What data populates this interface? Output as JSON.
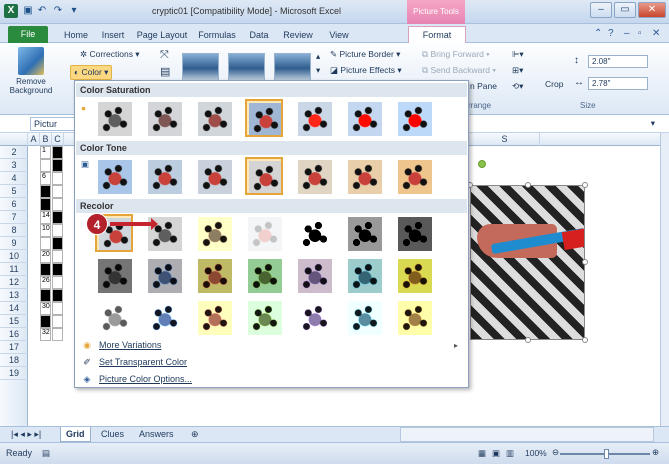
{
  "titlebar": {
    "app_icon": "X",
    "title": "cryptic01 [Compatibility Mode] - Microsoft Excel",
    "contextual_tab": "Picture Tools",
    "minimize": "–",
    "restore": "▭",
    "close": "✕"
  },
  "ribbon_tabs": [
    "File",
    "Home",
    "Insert",
    "Page Layout",
    "Formulas",
    "Data",
    "Review",
    "View",
    "Format"
  ],
  "ribbon": {
    "remove_background": "Remove Background",
    "corrections": "Corrections ▾",
    "color": "Color ▾",
    "picture_border": "Picture Border ▾",
    "picture_effects": "Picture Effects ▾",
    "bring_forward": "Bring Forward ▾",
    "send_backward": "Send Backward ▾",
    "selection_pane": "n Pane",
    "arrange_group": "rrange",
    "crop": "Crop",
    "height_value": "2.08\"",
    "width_value": "2.78\"",
    "size_group": "Size"
  },
  "formula_bar": {
    "name_box": "Pictur"
  },
  "sheet": {
    "column_headers": [
      "A",
      "B",
      "C",
      "S"
    ],
    "row_numbers": [
      "2",
      "3",
      "4",
      "5",
      "6",
      "7",
      "8",
      "9",
      "10",
      "11",
      "12",
      "13",
      "14",
      "15",
      "16",
      "17",
      "18",
      "19"
    ],
    "cell_numbers": {
      "r2": "1",
      "r4": "6",
      "r7": "14",
      "r8": "10",
      "r10": "20",
      "r12": "26",
      "r14": "30",
      "r16": "32"
    }
  },
  "gallery": {
    "color_saturation": "Color Saturation",
    "color_tone": "Color Tone",
    "recolor": "Recolor",
    "more_variations": "More Variations",
    "set_transparent_color": "Set Transparent Color",
    "picture_color_options": "Picture Color Options..."
  },
  "step_badge": "4",
  "sheet_tabs": [
    "Grid",
    "Clues",
    "Answers"
  ],
  "status": {
    "ready": "Ready",
    "zoom": "100%"
  },
  "colors": {
    "file_tab": "#2a8a3d",
    "picture_tools": "#e784b2",
    "selection_highlight": "#e6a53a",
    "step_badge": "#b3212a"
  }
}
